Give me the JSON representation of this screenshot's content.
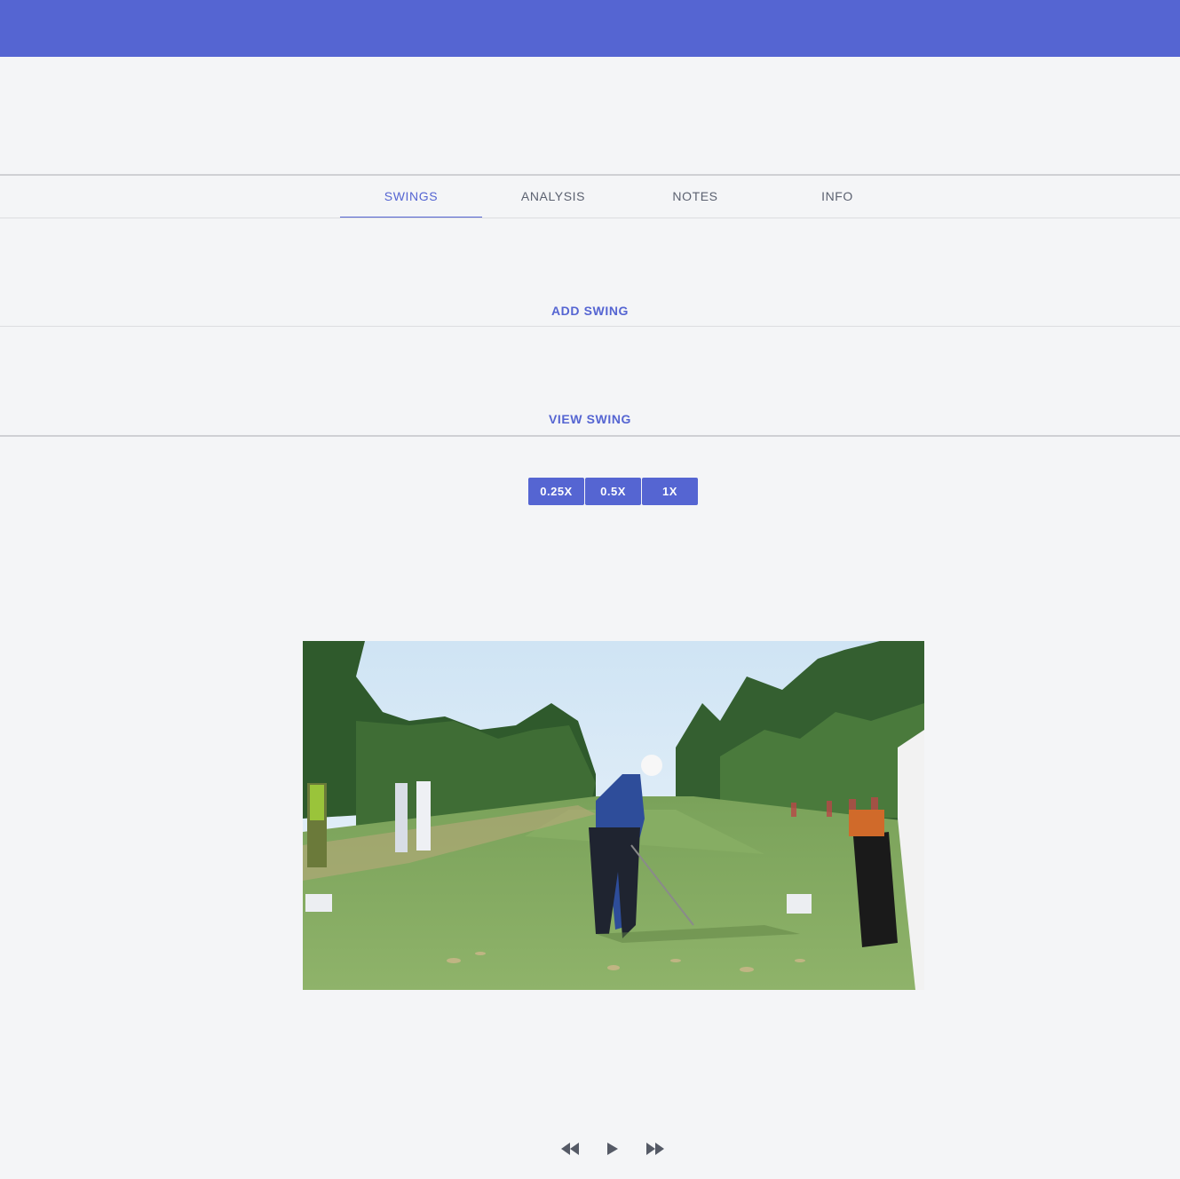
{
  "tabs": [
    {
      "label": "SWINGS",
      "active": true
    },
    {
      "label": "ANALYSIS",
      "active": false
    },
    {
      "label": "NOTES",
      "active": false
    },
    {
      "label": "INFO",
      "active": false
    }
  ],
  "actions": {
    "add_swing": "ADD SWING",
    "view_swing": "VIEW SWING"
  },
  "playback_speeds": [
    "0.25X",
    "0.5X",
    "1X"
  ],
  "player": {
    "controls": [
      "rewind-icon",
      "play-icon",
      "fast-forward-icon"
    ]
  },
  "colors": {
    "primary": "#5565d2",
    "background": "#f4f5f7"
  }
}
